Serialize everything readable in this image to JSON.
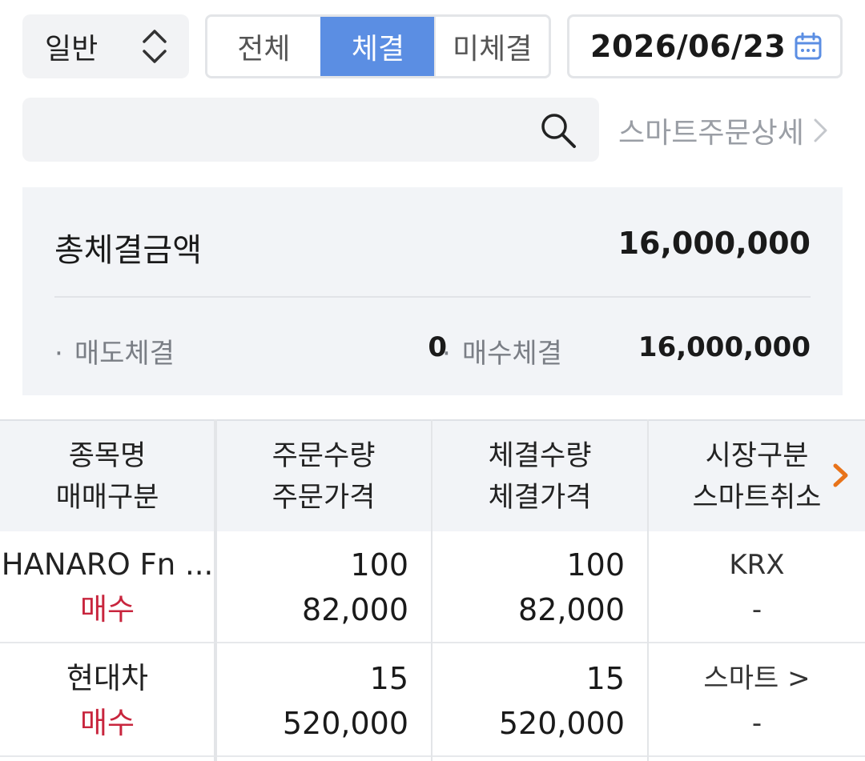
{
  "filter": {
    "order_type": "일반",
    "tabs": [
      "전체",
      "체결",
      "미체결"
    ],
    "active_tab": "체결",
    "date": "2026/06/23"
  },
  "search": {
    "placeholder": "",
    "smart_detail_link": "스마트주문상세"
  },
  "summary": {
    "title": "총체결금액",
    "total": "16,000,000",
    "sell_label": "매도체결",
    "sell_value": "0",
    "buy_label": "매수체결",
    "buy_value": "16,000,000",
    "bullet": "·"
  },
  "table": {
    "headers": [
      [
        "종목명",
        "매매구분"
      ],
      [
        "주문수량",
        "주문가격"
      ],
      [
        "체결수량",
        "체결가격"
      ],
      [
        "시장구분",
        "스마트취소"
      ]
    ],
    "rows": [
      {
        "name": "HANARO Fn ...",
        "side": "매수",
        "order_qty": "100",
        "order_price": "82,000",
        "exec_qty": "100",
        "exec_price": "82,000",
        "market": "KRX",
        "smart_cancel": "-"
      },
      {
        "name": "현대차",
        "side": "매수",
        "order_qty": "15",
        "order_price": "520,000",
        "exec_qty": "15",
        "exec_price": "520,000",
        "market": "스마트 >",
        "smart_cancel": "-"
      }
    ]
  },
  "colors": {
    "accent": "#5b8ee3",
    "buy_red": "#c8253d",
    "scroll_hint_orange": "#e8731a",
    "panel_bg": "#f2f4f7"
  }
}
